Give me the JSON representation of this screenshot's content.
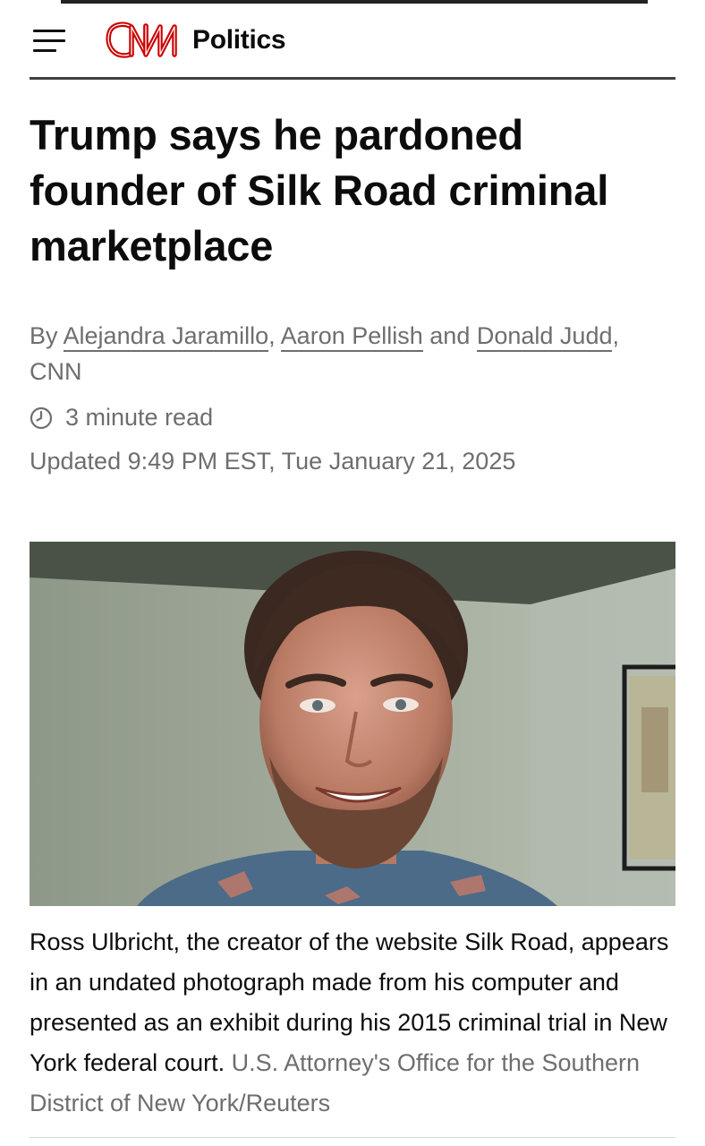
{
  "header": {
    "menu_icon": "hamburger-menu-icon",
    "logo_text": "CNN",
    "section": "Politics",
    "brand_color": "#cc0000"
  },
  "article": {
    "headline": "Trump says he pardoned founder of Silk Road criminal marketplace",
    "byline": {
      "prefix": "By",
      "authors": [
        "Alejandra Jaramillo",
        "Aaron Pellish",
        "Donald Judd"
      ],
      "separator_1": ",",
      "separator_2": "and",
      "suffix": ", CNN"
    },
    "read_time": "3 minute read",
    "read_time_icon": "clock-icon",
    "updated": "Updated 9:49 PM EST, Tue January 21, 2025"
  },
  "image": {
    "alt": "Ross Ulbricht",
    "caption": "Ross Ulbricht, the creator of the website Silk Road, appears in an undated photograph made from his computer and presented as an exhibit during his 2015 criminal trial in New York federal court.",
    "credit": "U.S. Attorney's Office for the Southern District of New York/Reuters"
  }
}
